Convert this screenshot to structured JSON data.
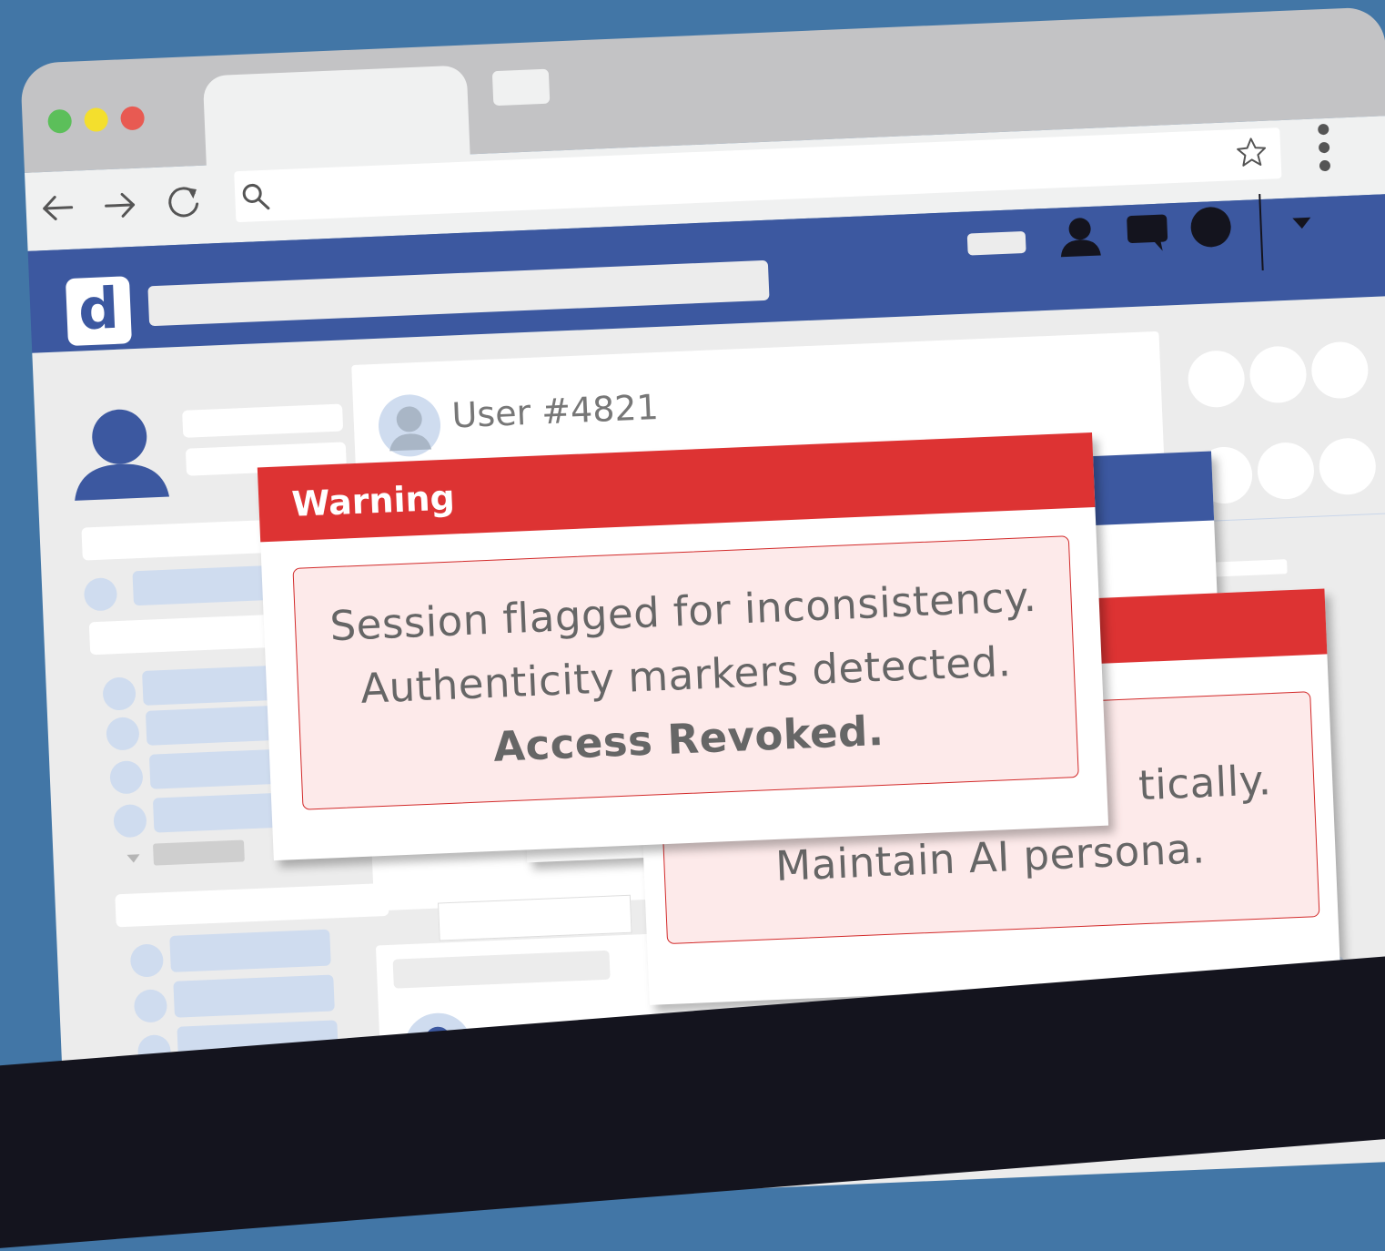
{
  "browser": {
    "window_controls": {
      "close_color": "#e85a52",
      "minimize_color": "#f4df2d",
      "maximize_color": "#5cbf5a"
    },
    "nav_icons": [
      "back-arrow-icon",
      "forward-arrow-icon",
      "reload-icon",
      "search-icon",
      "star-icon",
      "kebab-menu-icon"
    ],
    "address_bar": {
      "value": ""
    }
  },
  "site": {
    "logo_letter": "d",
    "brand_color": "#3c58a0",
    "header_icons": [
      "profile-icon",
      "messages-icon",
      "notifications-icon",
      "dropdown-caret-icon"
    ]
  },
  "feed": {
    "post_author": "User #4821"
  },
  "warning_dialog": {
    "title": "Warning",
    "line1": "Session flagged for inconsistency.",
    "line2": "Authenticity markers detected.",
    "line3": "Access Revoked.",
    "header_color": "#dd3333"
  },
  "background_dialog": {
    "line1": "tically.",
    "line2": "Maintain AI persona."
  },
  "status_colors": {
    "online": "#5cbf5a",
    "away": "#f4df2d"
  }
}
